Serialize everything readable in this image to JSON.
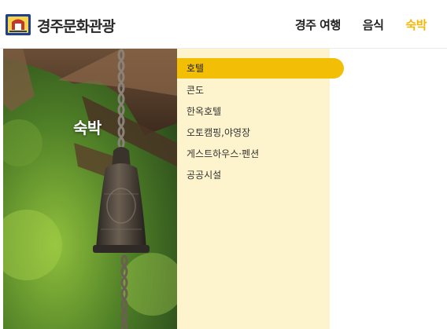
{
  "header": {
    "brand": "경주문화관광",
    "nav": [
      "경주 여행",
      "음식",
      "숙박"
    ],
    "active_nav": 2
  },
  "hero": {
    "title": "숙박"
  },
  "submenu": {
    "items": [
      "호텔",
      "콘도",
      "한옥호텔",
      "오토캠핑,야영장",
      "게스트하우스·펜션",
      "공공시설"
    ],
    "active": 0
  },
  "colors": {
    "accent": "#f3be06",
    "panel": "#fdf3cc",
    "logo_blue": "#1f3f8f"
  }
}
